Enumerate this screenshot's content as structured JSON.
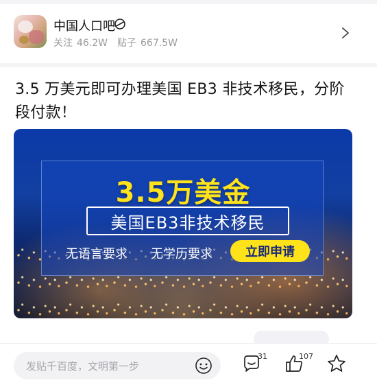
{
  "forum": {
    "name": "中国人口吧",
    "follow_label": "关注",
    "follow_count": "46.2W",
    "posts_label": "贴子",
    "posts_count": "667.5W"
  },
  "post": {
    "title": "3.5 万美元即可办理美国 EB3 非技术移民，分阶段付款！"
  },
  "banner": {
    "headline": "3.5万美金",
    "subtitle": "美国EB3非技术移民",
    "requirement_1": "无语言要求",
    "requirement_2": "无学历要求",
    "apply_label": "立即申请"
  },
  "bottom_bar": {
    "input_placeholder": "发贴千百度，文明第一步",
    "comment_count": "31",
    "like_count": "107"
  },
  "icons": [
    "forum-badge-icon",
    "chevron-right-icon",
    "emoji-icon",
    "comment-icon",
    "like-icon",
    "star-icon"
  ],
  "colors": {
    "accent_yellow": "#ffe31a",
    "banner_blue": "#0c3aa8",
    "text_secondary": "#9a9a9a"
  }
}
